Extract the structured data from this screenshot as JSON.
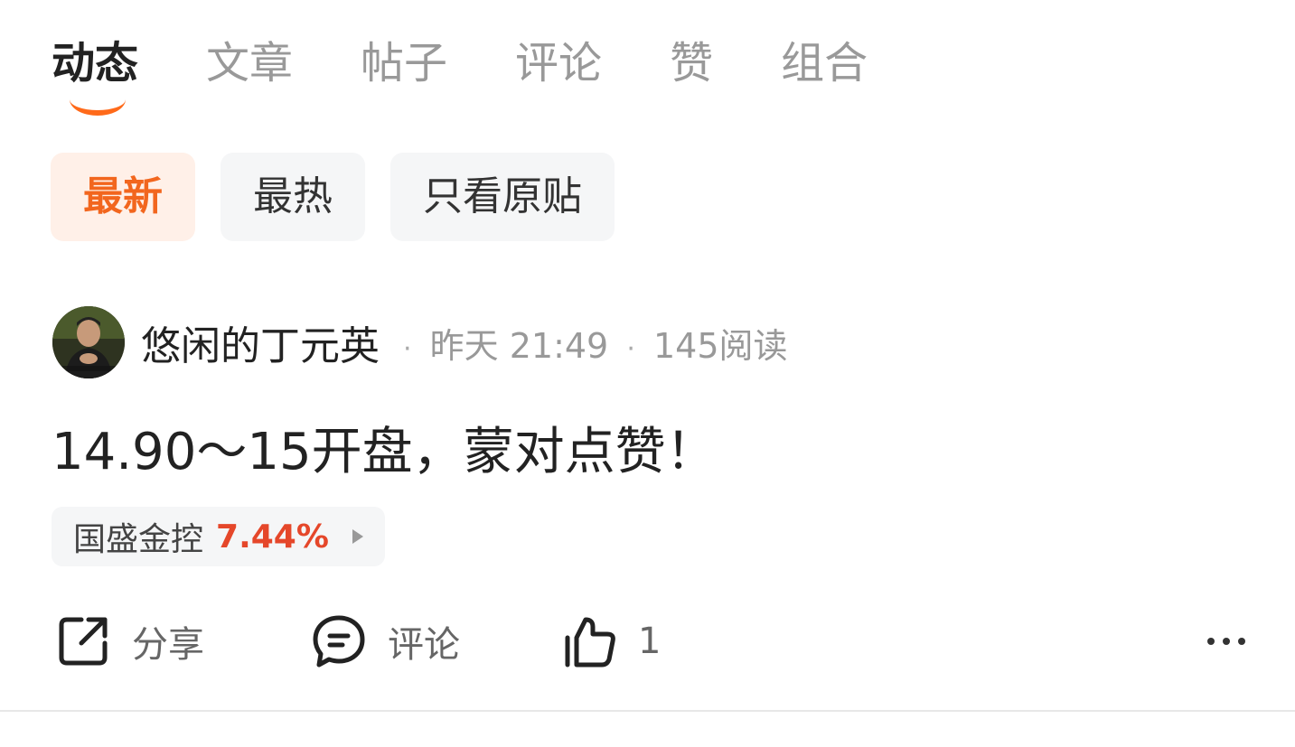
{
  "tabs": [
    {
      "label": "动态",
      "active": true
    },
    {
      "label": "文章",
      "active": false
    },
    {
      "label": "帖子",
      "active": false
    },
    {
      "label": "评论",
      "active": false
    },
    {
      "label": "赞",
      "active": false
    },
    {
      "label": "组合",
      "active": false
    }
  ],
  "filters": [
    {
      "label": "最新",
      "active": true
    },
    {
      "label": "最热",
      "active": false
    },
    {
      "label": "只看原贴",
      "active": false
    }
  ],
  "post": {
    "author": "悠闲的丁元英",
    "time": "昨天 21:49",
    "reads": "145阅读",
    "text": "14.90～15开盘，蒙对点赞！",
    "stock": {
      "name": "国盛金控",
      "change": "7.44%"
    },
    "actions": {
      "share": "分享",
      "comment": "评论",
      "like_count": "1"
    }
  },
  "colors": {
    "accent": "#ff6a1a",
    "stock_up": "#e5472a",
    "chip_bg": "#f5f6f7"
  },
  "icons": [
    "share-icon",
    "comment-icon",
    "like-icon",
    "more-icon",
    "chevron-right-icon"
  ]
}
